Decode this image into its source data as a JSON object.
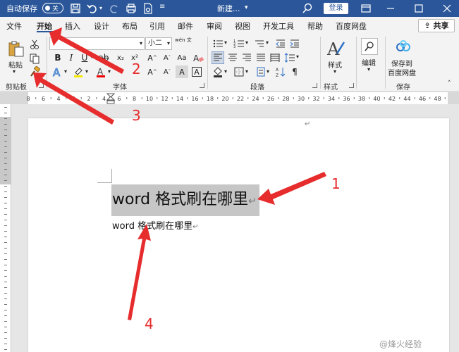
{
  "titlebar": {
    "autosave_label": "自动保存",
    "autosave_state": "关",
    "doc_title": "新建...",
    "login_label": "登录"
  },
  "tabs": [
    {
      "label": "文件"
    },
    {
      "label": "开始"
    },
    {
      "label": "插入"
    },
    {
      "label": "设计"
    },
    {
      "label": "布局"
    },
    {
      "label": "引用"
    },
    {
      "label": "邮件"
    },
    {
      "label": "审阅"
    },
    {
      "label": "视图"
    },
    {
      "label": "开发工具"
    },
    {
      "label": "帮助"
    },
    {
      "label": "百度网盘"
    }
  ],
  "share_label": "共享",
  "ribbon": {
    "paste_label": "粘贴",
    "font_size": "小二",
    "wen_icon_text": "wén 文",
    "style_label": "样式",
    "edit_label": "编辑",
    "save_baidu_label_1": "保存到",
    "save_baidu_label_2": "百度网盘",
    "groups": {
      "clipboard": "剪贴板",
      "font": "字体",
      "paragraph": "段落",
      "styles": "样式",
      "save": "保存"
    }
  },
  "ruler": {
    "labels": [
      "8",
      "6",
      "4",
      "2",
      "2",
      "4",
      "6",
      "8",
      "10",
      "12",
      "14",
      "16",
      "18",
      "20",
      "22",
      "24",
      "26",
      "28",
      "30",
      "32",
      "34",
      "36",
      "38",
      "40",
      "42",
      "44",
      "46",
      "48"
    ]
  },
  "document": {
    "heading": "word 格式刷在哪里",
    "paragraph": "word 格式刷在哪里",
    "para_mark": "↵"
  },
  "annotations": [
    "1",
    "2",
    "3",
    "4"
  ],
  "watermark": "@烽火经验",
  "colors": {
    "titlebar": "#2b579a",
    "arrow": "#e62c2c",
    "selection": "#c6c6c6"
  }
}
